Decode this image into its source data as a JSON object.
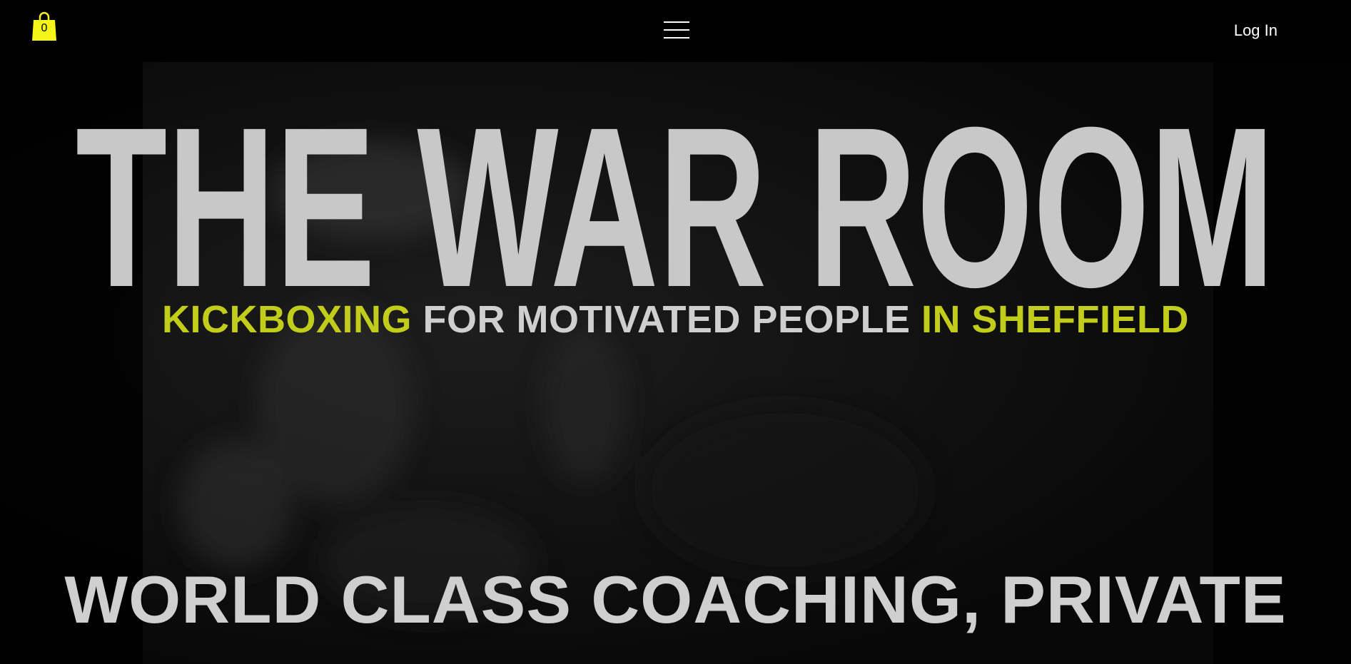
{
  "header": {
    "cart_count": "0",
    "menu_icon": "hamburger-menu-icon",
    "cart_icon": "shopping-bag-icon",
    "login_label": "Log In"
  },
  "hero": {
    "title": "THE WAR ROOM",
    "subtitle": {
      "part1": "KICKBOXING",
      "part2": " FOR MOTIVATED PEOPLE ",
      "part3": "IN SHEFFIELD"
    },
    "tagline": "WORLD CLASS COACHING, PRIVATE"
  },
  "colors": {
    "accent": "#c2cc1a",
    "cart": "#f5f51a",
    "text": "#cfcfcf",
    "background": "#000000"
  }
}
